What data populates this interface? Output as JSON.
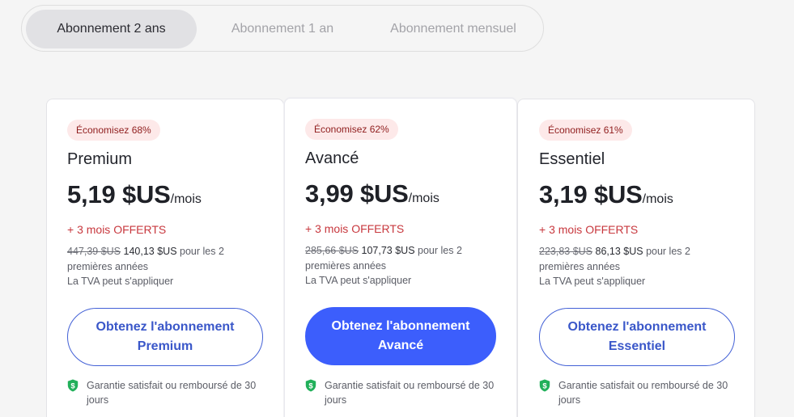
{
  "tabs": [
    {
      "label": "Abonnement 2 ans",
      "active": true
    },
    {
      "label": "Abonnement 1 an",
      "active": false
    },
    {
      "label": "Abonnement mensuel",
      "active": false
    }
  ],
  "plans": [
    {
      "badge": "Économisez 68%",
      "name": "Premium",
      "price": "5,19 $US",
      "per": "/mois",
      "offer": "+ 3 mois OFFERTS",
      "old_price": "447,39 $US",
      "new_price": "140,13 $US",
      "period_text": " pour les 2 premières années",
      "vat": "La TVA peut s'appliquer",
      "cta": "Obtenez l'abonnement Premium",
      "guarantee": "Garantie satisfait ou remboursé de 30 jours"
    },
    {
      "badge": "Économisez 62%",
      "name": "Avancé",
      "price": "3,99 $US",
      "per": "/mois",
      "offer": "+ 3 mois OFFERTS",
      "old_price": "285,66 $US",
      "new_price": "107,73 $US",
      "period_text": " pour les 2 premières années",
      "vat": "La TVA peut s'appliquer",
      "cta": "Obtenez l'abonnement Avancé",
      "guarantee": "Garantie satisfait ou remboursé de 30 jours"
    },
    {
      "badge": "Économisez 61%",
      "name": "Essentiel",
      "price": "3,19 $US",
      "per": "/mois",
      "offer": "+ 3 mois OFFERTS",
      "old_price": "223,83 $US",
      "new_price": "86,13 $US",
      "period_text": " pour les 2 premières années",
      "vat": "La TVA peut s'appliquer",
      "cta": "Obtenez l'abonnement Essentiel",
      "guarantee": "Garantie satisfait ou remboursé de 30 jours"
    }
  ],
  "colors": {
    "accent": "#3c5efc",
    "offer": "#c8383e",
    "badge_bg": "#fde9e9",
    "shield": "#21b05a"
  },
  "icons": {
    "guarantee": "shield-check-icon"
  }
}
